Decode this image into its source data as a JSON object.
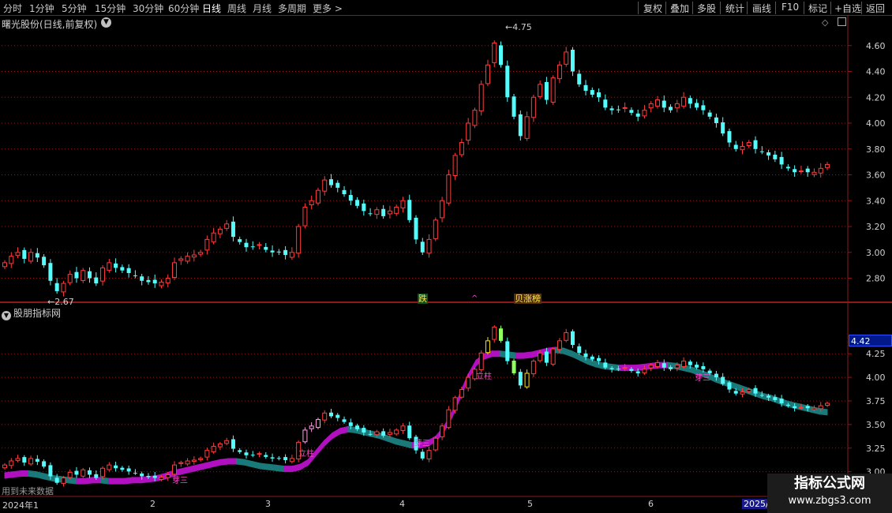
{
  "toolbar": {
    "periods": [
      "分时",
      "1分钟",
      "5分钟",
      "15分钟",
      "30分钟",
      "60分钟",
      "日线",
      "周线",
      "月线",
      "多周期",
      "更多 >"
    ],
    "active_period": "日线",
    "right_buttons": [
      "复权",
      "叠加",
      "多股",
      "统计",
      "画线",
      "F10",
      "标记",
      "+自选",
      "返回"
    ]
  },
  "stock": {
    "title": "曙光股份(日线,前复权)",
    "high_label": "4.75",
    "low_label": "2.67"
  },
  "events": {
    "fall": "跌",
    "up": "^",
    "rank": "贝涨榜"
  },
  "indicator": {
    "title": "股朋指标网",
    "future_note": "用到未来数据",
    "cursor_price": "4.42",
    "annotations": [
      "芽三",
      "芽三",
      "芽三",
      "立柱",
      "立柱"
    ]
  },
  "date_axis": {
    "start": "2024年1",
    "months": [
      "2",
      "3",
      "4",
      "5",
      "6"
    ],
    "end": "2025/"
  },
  "watermark": {
    "title": "指标公式网",
    "url": "www.zbgs3.com"
  },
  "colors": {
    "up": "#ff3c3c",
    "down": "#54fcfc",
    "grid": "#8c1a1a",
    "band_up": "#b010c0",
    "band_down": "#1a7a7a",
    "axis": "#8c1a1a"
  },
  "chart_data": [
    {
      "type": "candlestick",
      "title": "曙光股份(日线,前复权)",
      "y_ticks": [
        2.8,
        3.0,
        3.2,
        3.4,
        3.6,
        3.8,
        4.0,
        4.2,
        4.4,
        4.6
      ],
      "ylim": [
        2.62,
        4.8
      ],
      "max_label": 4.75,
      "min_label": 2.67,
      "closes": [
        2.92,
        2.97,
        3.0,
        2.95,
        3.0,
        2.96,
        2.9,
        2.78,
        2.7,
        2.76,
        2.83,
        2.8,
        2.86,
        2.8,
        2.76,
        2.88,
        2.92,
        2.88,
        2.86,
        2.84,
        2.82,
        2.78,
        2.77,
        2.76,
        2.77,
        2.8,
        2.92,
        2.95,
        2.97,
        2.98,
        3.0,
        3.1,
        3.15,
        3.18,
        3.22,
        3.12,
        3.08,
        3.04,
        3.04,
        3.06,
        3.02,
        3.0,
        3.0,
        2.98,
        3.0,
        3.2,
        3.35,
        3.4,
        3.48,
        3.56,
        3.52,
        3.5,
        3.45,
        3.4,
        3.36,
        3.32,
        3.3,
        3.33,
        3.28,
        3.32,
        3.35,
        3.4,
        3.25,
        3.1,
        3.0,
        3.1,
        3.25,
        3.4,
        3.6,
        3.75,
        3.85,
        4.0,
        4.1,
        4.3,
        4.45,
        4.62,
        4.45,
        4.2,
        4.05,
        3.9,
        4.05,
        4.2,
        4.3,
        4.18,
        4.35,
        4.45,
        4.55,
        4.4,
        4.3,
        4.25,
        4.22,
        4.2,
        4.12,
        4.1,
        4.1,
        4.12,
        4.08,
        4.05,
        4.1,
        4.15,
        4.18,
        4.12,
        4.1,
        4.15,
        4.2,
        4.15,
        4.12,
        4.1,
        4.05,
        4.0,
        3.92,
        3.85,
        3.8,
        3.82,
        3.85,
        3.8,
        3.78,
        3.75,
        3.72,
        3.68,
        3.65,
        3.62,
        3.63,
        3.62,
        3.62,
        3.65,
        3.68
      ]
    },
    {
      "type": "area",
      "title": "股朋指标网",
      "y_ticks": [
        3.0,
        3.25,
        3.5,
        3.75,
        4.0,
        4.25
      ],
      "ylim": [
        2.88,
        4.62
      ],
      "series": [
        {
          "values": [
            2.96,
            2.97,
            2.98,
            2.98,
            2.97,
            2.95,
            2.93,
            2.92,
            2.91,
            2.9,
            2.9,
            2.91,
            2.91,
            2.9,
            2.9,
            2.9,
            2.91,
            2.91,
            2.92,
            2.93,
            2.95,
            2.98,
            3.0,
            3.02,
            3.04,
            3.06,
            3.08,
            3.1,
            3.11,
            3.11,
            3.1,
            3.08,
            3.06,
            3.05,
            3.04,
            3.03,
            3.03,
            3.05,
            3.1,
            3.2,
            3.3,
            3.38,
            3.43,
            3.45,
            3.44,
            3.42,
            3.4,
            3.38,
            3.35,
            3.32,
            3.3,
            3.28,
            3.28,
            3.3,
            3.35,
            3.45,
            3.6,
            3.8,
            4.0,
            4.15,
            4.22,
            4.25,
            4.25,
            4.24,
            4.23,
            4.23,
            4.24,
            4.26,
            4.28,
            4.29,
            4.28,
            4.25,
            4.21,
            4.17,
            4.14,
            4.12,
            4.11,
            4.1,
            4.1,
            4.1,
            4.11,
            4.12,
            4.13,
            4.13,
            4.12,
            4.1,
            4.08,
            4.05,
            4.02,
            3.98,
            3.95,
            3.92,
            3.89,
            3.86,
            3.83,
            3.8,
            3.78,
            3.75,
            3.72,
            3.7,
            3.68,
            3.66,
            3.64,
            3.63
          ]
        }
      ]
    }
  ]
}
